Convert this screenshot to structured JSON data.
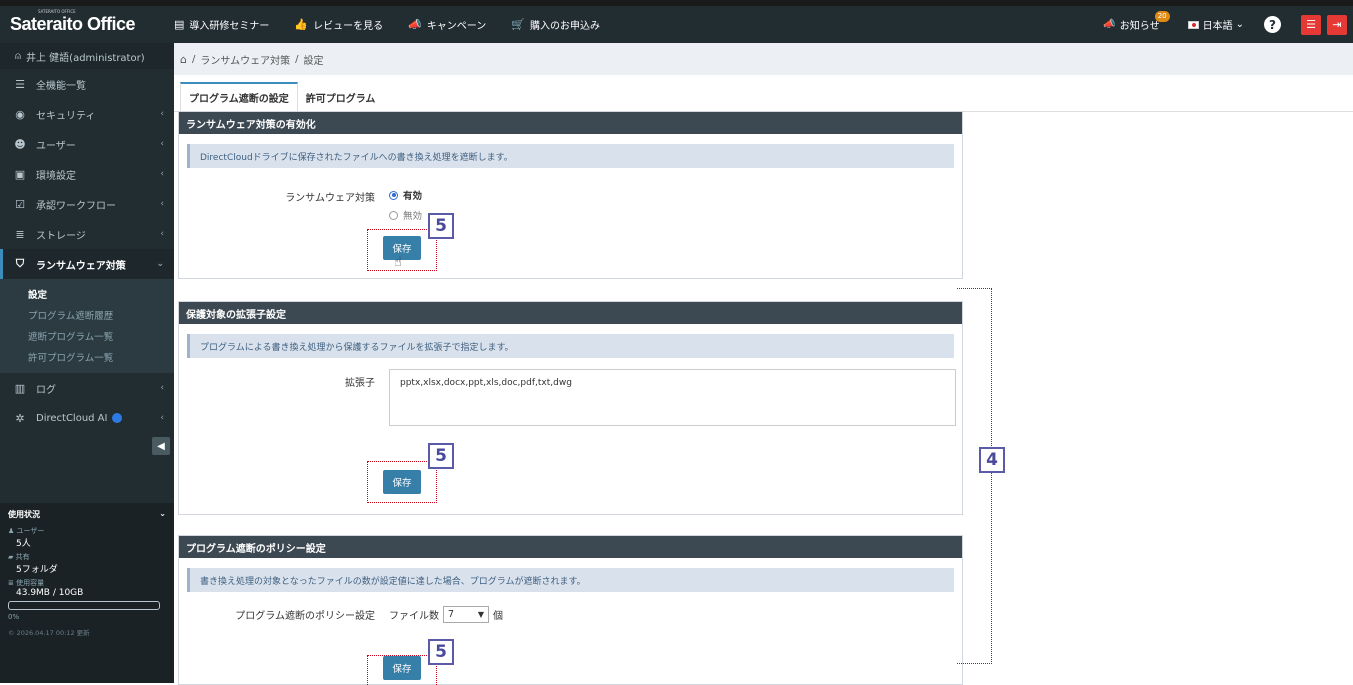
{
  "app": {
    "logo": "Sateraito Office",
    "logo_small": "SATERAITO OFFICE"
  },
  "topnav": [
    {
      "icon": "book-icon",
      "label": "導入研修セミナー"
    },
    {
      "icon": "thumbs-up-icon",
      "label": "レビューを見る"
    },
    {
      "icon": "megaphone-icon",
      "label": "キャンペーン"
    },
    {
      "icon": "cart-icon",
      "label": "購入のお申込み"
    }
  ],
  "topright": {
    "notifications": "お知らせ",
    "notification_count": "20",
    "language": "日本語",
    "language_arrow": "⌄"
  },
  "sidebar": {
    "user": "井上 健語(administrator)",
    "items": [
      {
        "icon": "list-icon",
        "label": "全機能一覧",
        "arrow": ""
      },
      {
        "icon": "globe-icon",
        "label": "セキュリティ",
        "arrow": "‹"
      },
      {
        "icon": "user-icon",
        "label": "ユーザー",
        "arrow": "‹"
      },
      {
        "icon": "settings-icon",
        "label": "環境設定",
        "arrow": "‹"
      },
      {
        "icon": "check-icon",
        "label": "承認ワークフロー",
        "arrow": "‹"
      },
      {
        "icon": "storage-icon",
        "label": "ストレージ",
        "arrow": "‹"
      },
      {
        "icon": "shield-icon",
        "label": "ランサムウェア対策",
        "arrow": "⌄"
      }
    ],
    "sub_items": [
      "設定",
      "プログラム遮断履歴",
      "遮断プログラム一覧",
      "許可プログラム一覧"
    ],
    "items2": [
      {
        "icon": "chart-icon",
        "label": "ログ",
        "arrow": "‹"
      },
      {
        "icon": "ai-icon",
        "label": "DirectCloud AI",
        "arrow": "‹"
      }
    ],
    "usage": {
      "title": "使用状況",
      "users_label": "ユーザー",
      "users_value": "5人",
      "shared_label": "共有",
      "shared_value": "5フォルダ",
      "capacity_label": "使用容量",
      "capacity_value": "43.9MB / 10GB",
      "percent": "0%",
      "updated": "© 2026.04.17 00:12 更新"
    }
  },
  "breadcrumb": {
    "home": "⌂",
    "sep": "/",
    "level1": "ランサムウェア対策",
    "level2": "設定"
  },
  "tabs": [
    "プログラム遮断の設定",
    "許可プログラム"
  ],
  "panel1": {
    "title": "ランサムウェア対策の有効化",
    "info": "DirectCloudドライブに保存されたファイルへの書き換え処理を遮断します。",
    "label": "ランサムウェア対策",
    "options": [
      "有効",
      "無効"
    ],
    "selected": "有効",
    "save": "保存"
  },
  "panel2": {
    "title": "保護対象の拡張子設定",
    "info": "プログラムによる書き換え処理から保護するファイルを拡張子で指定します。",
    "label": "拡張子",
    "value": "pptx,xlsx,docx,ppt,xls,doc,pdf,txt,dwg",
    "save": "保存"
  },
  "panel3": {
    "title": "プログラム遮断のポリシー設定",
    "info": "書き換え処理の対象となったファイルの数が設定値に達した場合、プログラムが遮断されます。",
    "label": "プログラム遮断のポリシー設定",
    "prefix": "ファイル数",
    "value": "7",
    "suffix": "個",
    "save": "保存"
  },
  "callouts": {
    "save_marker": "5",
    "bracket_marker": "4"
  },
  "colors": {
    "sidebar": "#222d32",
    "accent": "#3c8dbc",
    "callout_border": "#5a5aa8",
    "dotted": "#d0021b"
  }
}
